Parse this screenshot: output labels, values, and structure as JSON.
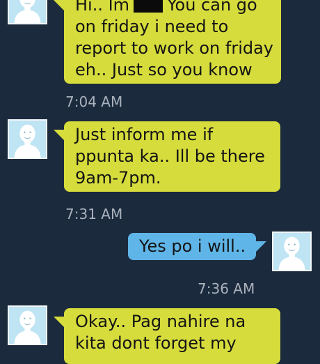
{
  "messages": [
    {
      "direction": "incoming",
      "lines": [
        "Hi.. Im",
        "You can go",
        "on friday i need to",
        "report to work on friday",
        "eh.. Just so you know"
      ],
      "time": "7:04 AM"
    },
    {
      "direction": "incoming",
      "lines": [
        "Just inform me if",
        "ppunta ka.. Ill be there",
        "9am-7pm."
      ],
      "time": "7:31 AM"
    },
    {
      "direction": "outgoing",
      "lines": [
        "Yes po i will.."
      ],
      "time": "7:36 AM"
    },
    {
      "direction": "incoming",
      "lines": [
        "Okay.. Pag nahire na",
        "kita dont forget my"
      ],
      "time": ""
    }
  ],
  "icons": {
    "avatar": "default-person-avatar-icon"
  },
  "colors": {
    "background": "#1c2a3d",
    "incoming_bubble": "#d6dc3c",
    "outgoing_bubble": "#5fb5e8",
    "timestamp": "#aab2bd",
    "avatar_bg": "#bfe4f3"
  }
}
